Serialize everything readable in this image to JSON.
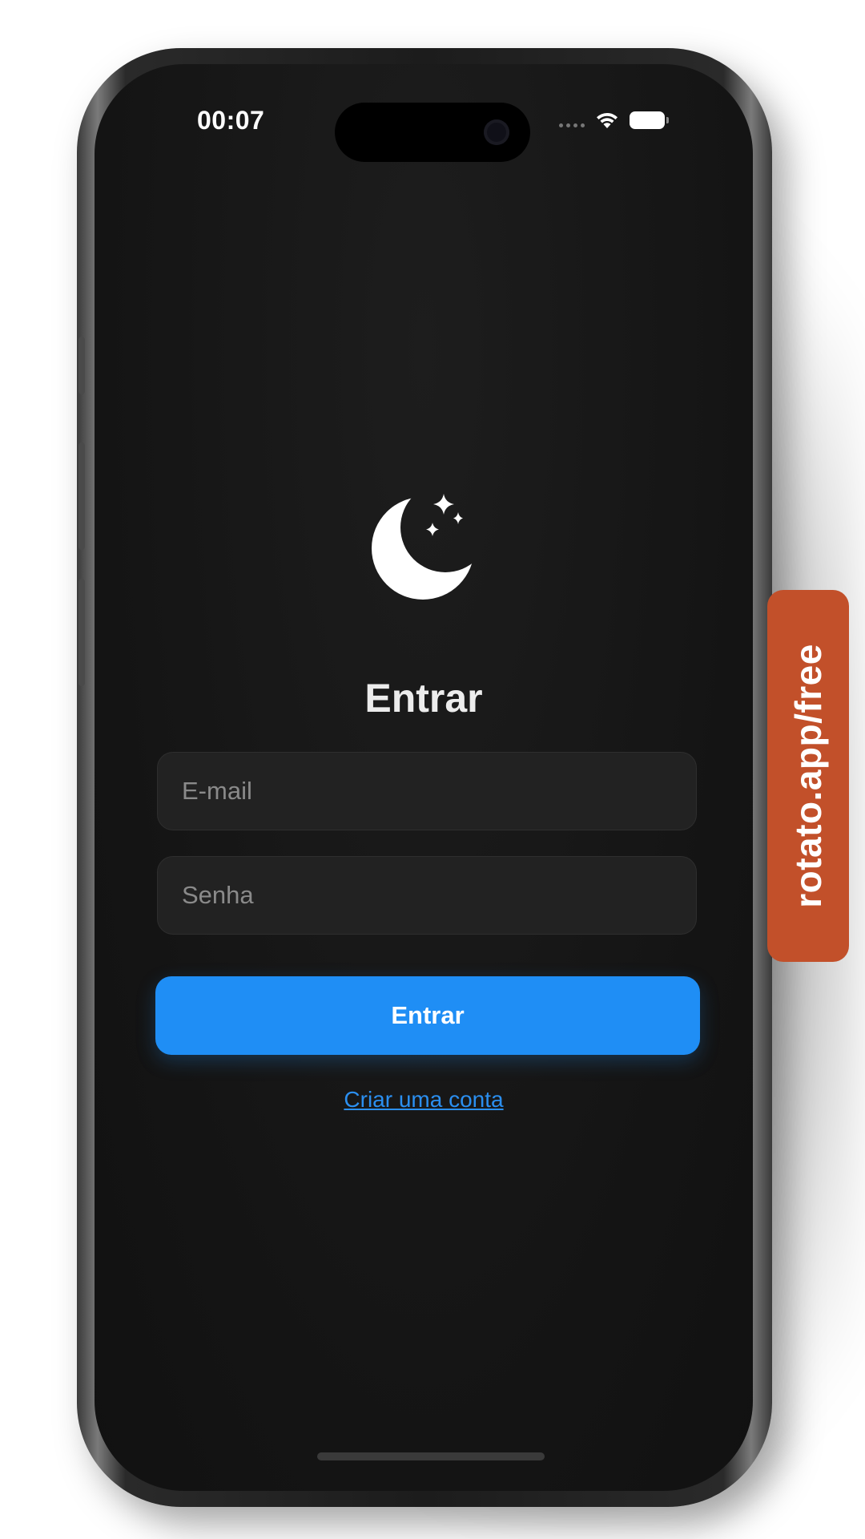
{
  "status_bar": {
    "time": "00:07",
    "icons": [
      "signal-dots-icon",
      "wifi-icon",
      "battery-icon"
    ]
  },
  "logo": {
    "icon": "moon-stars-icon"
  },
  "login": {
    "title": "Entrar",
    "email_placeholder": "E-mail",
    "email_value": "",
    "password_placeholder": "Senha",
    "password_value": "",
    "submit_label": "Entrar",
    "signup_link": "Criar uma conta"
  },
  "watermark": {
    "text": "rotato.app/free"
  },
  "colors": {
    "background": "#141414",
    "field_background": "#222222",
    "accent": "#1f8ef5",
    "link": "#2b8ff0",
    "title_text": "#ececec",
    "watermark": "#c2502a"
  }
}
